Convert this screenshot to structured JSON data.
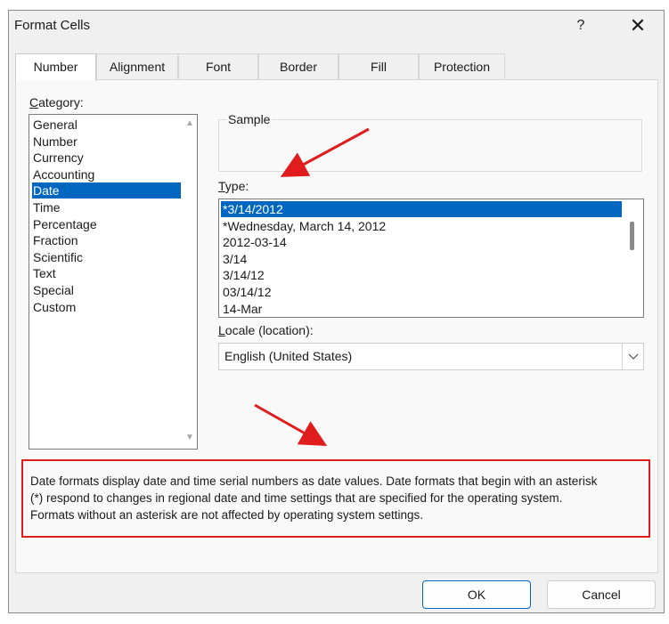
{
  "dialog": {
    "title": "Format Cells",
    "help_label": "?",
    "close_label": "✕"
  },
  "tabs": [
    {
      "label": "Number",
      "active": true
    },
    {
      "label": "Alignment",
      "active": false
    },
    {
      "label": "Font",
      "active": false
    },
    {
      "label": "Border",
      "active": false
    },
    {
      "label": "Fill",
      "active": false
    },
    {
      "label": "Protection",
      "active": false
    }
  ],
  "category": {
    "label_accel": "C",
    "label_rest": "ategory:",
    "items": [
      "General",
      "Number",
      "Currency",
      "Accounting",
      "Date",
      "Time",
      "Percentage",
      "Fraction",
      "Scientific",
      "Text",
      "Special",
      "Custom"
    ],
    "selected": "Date"
  },
  "sample": {
    "legend": "Sample",
    "value": ""
  },
  "type": {
    "label_accel": "T",
    "label_rest": "ype:",
    "items": [
      "*3/14/2012",
      "*Wednesday, March 14, 2012",
      "2012-03-14",
      "3/14",
      "3/14/12",
      "03/14/12",
      "14-Mar"
    ],
    "selected": "*3/14/2012"
  },
  "locale": {
    "label_accel": "L",
    "label_rest": "ocale (location):",
    "value": "English (United States)"
  },
  "description": {
    "lines": [
      "Date formats display date and time serial numbers as date values.  Date formats that begin with an asterisk",
      "(*) respond to changes in regional date and time settings that are specified for the operating system.",
      "Formats without an asterisk are not affected by operating system settings."
    ]
  },
  "buttons": {
    "ok": "OK",
    "cancel": "Cancel"
  },
  "colors": {
    "selection": "#0067c0",
    "annotation": "#e01c1c"
  },
  "icons": {
    "scroll_up": "scroll-up-arrow-icon",
    "scroll_down": "scroll-down-arrow-icon",
    "dropdown": "chevron-down-icon"
  }
}
